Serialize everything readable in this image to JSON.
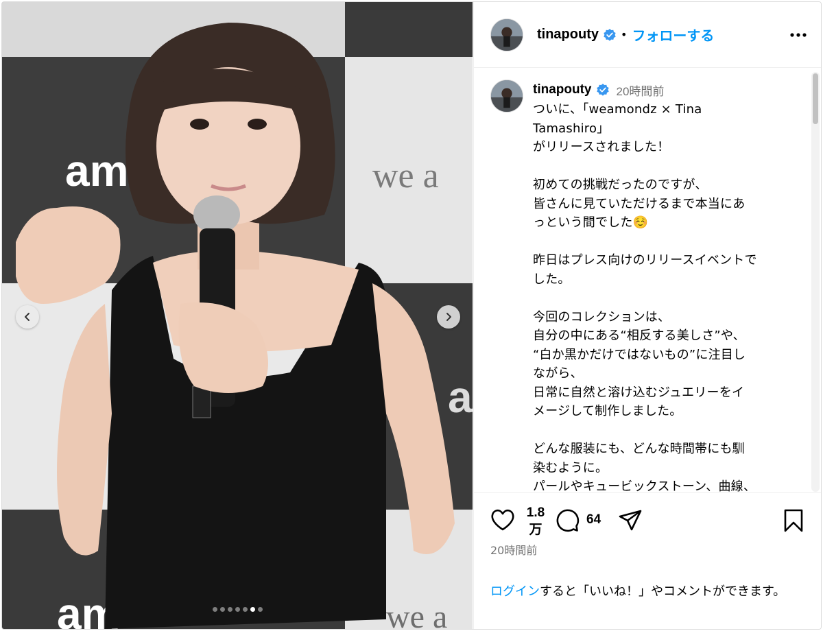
{
  "post": {
    "username": "tinapouty",
    "verified": true,
    "separator": "•",
    "follow_label": "フォローする",
    "more_icon": "more-horizontal-icon"
  },
  "media": {
    "carousel_count": 7,
    "active_index": 5,
    "prev_icon": "chevron-left-icon",
    "next_icon": "chevron-right-icon",
    "backdrop_text": [
      "am",
      "we a",
      "am",
      "we a"
    ]
  },
  "caption": {
    "username": "tinapouty",
    "time": "20時間前",
    "text": "ついに、「weamondz × Tina\nTamashiro」\nがリリースされました！\n\n初めての挑戦だったのですが、\n皆さんに見ていただけるまで本当にあ\nっという間でした☺️\n\n昨日はプレス向けのリリースイベントで\nした。\n\n今回のコレクションは、\n自分の中にある“相反する美しさ”や、\n“白か黒かだけではないもの”に注目し\nながら、\n日常に自然と溶け込むジュエリーをイ\nメージして制作しました。\n\nどんな服装にも、どんな時間帯にも馴\n染むように。\nパールやキュービックストーン、曲線、"
  },
  "actions": {
    "like_icon": "heart-icon",
    "like_count_line1": "1.8",
    "like_count_line2": "万",
    "comment_icon": "comment-icon",
    "comment_count": "64",
    "share_icon": "share-icon",
    "save_icon": "bookmark-icon",
    "post_time": "20時間前"
  },
  "login_prompt": {
    "link": "ログイン",
    "text": "すると「いいね！」やコメントができます。"
  },
  "colors": {
    "link_blue": "#0095f6",
    "verified_blue": "#3897f0",
    "muted_text": "#737373",
    "border": "#dbdbdb"
  }
}
